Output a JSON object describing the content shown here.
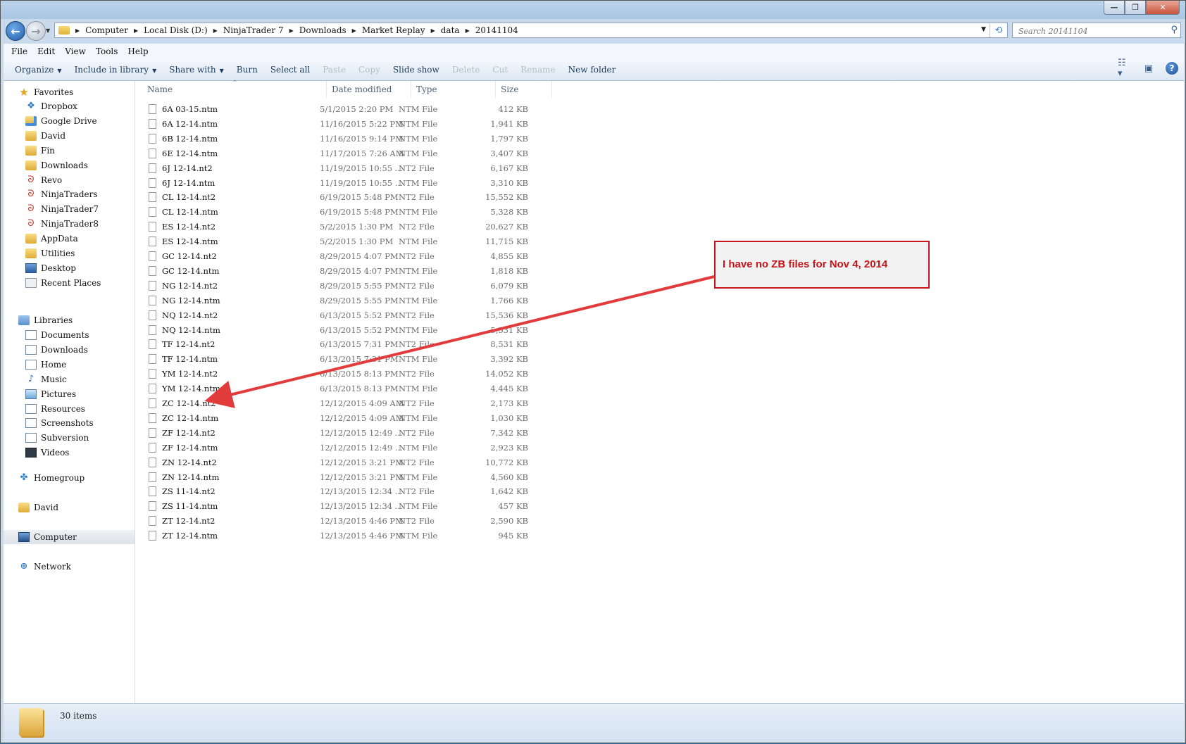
{
  "window": {
    "controls": {
      "minimize": "—",
      "maximize": "❐",
      "close": "✕"
    }
  },
  "address": {
    "crumbs": [
      "Computer",
      "Local Disk (D:)",
      "NinjaTrader 7",
      "Downloads",
      "Market Replay",
      "data",
      "20141104"
    ],
    "search_placeholder": "Search 20141104"
  },
  "menu": [
    "File",
    "Edit",
    "View",
    "Tools",
    "Help"
  ],
  "toolbar": {
    "organize": "Organize",
    "include_in_library": "Include in library",
    "share_with": "Share with",
    "burn": "Burn",
    "select_all": "Select all",
    "paste": "Paste",
    "copy": "Copy",
    "slide_show": "Slide show",
    "delete": "Delete",
    "cut": "Cut",
    "rename": "Rename",
    "new_folder": "New folder"
  },
  "nav": {
    "favorites_header": "Favorites",
    "favorites": [
      {
        "label": "Dropbox",
        "icon": "dropbox-icon"
      },
      {
        "label": "Google Drive",
        "icon": "google-drive-icon"
      },
      {
        "label": "David",
        "icon": "user-folder-icon"
      },
      {
        "label": "Fin",
        "icon": "folder-icon"
      },
      {
        "label": "Downloads",
        "icon": "folder-icon"
      },
      {
        "label": "Revo",
        "icon": "ninja-icon"
      },
      {
        "label": "NinjaTraders",
        "icon": "ninja-icon"
      },
      {
        "label": "NinjaTrader7",
        "icon": "ninja-icon"
      },
      {
        "label": "NinjaTrader8",
        "icon": "ninja-icon"
      },
      {
        "label": "AppData",
        "icon": "folder-icon"
      },
      {
        "label": "Utilities",
        "icon": "folder-icon"
      },
      {
        "label": "Desktop",
        "icon": "desktop-icon"
      },
      {
        "label": "Recent Places",
        "icon": "recent-places-icon"
      }
    ],
    "libraries_header": "Libraries",
    "libraries": [
      {
        "label": "Documents",
        "icon": "documents-icon"
      },
      {
        "label": "Downloads",
        "icon": "documents-icon"
      },
      {
        "label": "Home",
        "icon": "documents-icon"
      },
      {
        "label": "Music",
        "icon": "music-icon"
      },
      {
        "label": "Pictures",
        "icon": "pictures-icon"
      },
      {
        "label": "Resources",
        "icon": "documents-icon"
      },
      {
        "label": "Screenshots",
        "icon": "documents-icon"
      },
      {
        "label": "Subversion",
        "icon": "documents-icon"
      },
      {
        "label": "Videos",
        "icon": "videos-icon"
      }
    ],
    "homegroup": "Homegroup",
    "user": "David",
    "computer": "Computer",
    "network": "Network"
  },
  "columns": {
    "name": "Name",
    "date": "Date modified",
    "type": "Type",
    "size": "Size"
  },
  "files": [
    {
      "name": "6A 03-15.ntm",
      "date": "5/1/2015 2:20 PM",
      "type": "NTM File",
      "size": "412 KB"
    },
    {
      "name": "6A 12-14.ntm",
      "date": "11/16/2015 5:22 PM",
      "type": "NTM File",
      "size": "1,941 KB"
    },
    {
      "name": "6B 12-14.ntm",
      "date": "11/16/2015 9:14 PM",
      "type": "NTM File",
      "size": "1,797 KB"
    },
    {
      "name": "6E 12-14.ntm",
      "date": "11/17/2015 7:26 AM",
      "type": "NTM File",
      "size": "3,407 KB"
    },
    {
      "name": "6J 12-14.nt2",
      "date": "11/19/2015 10:55 ...",
      "type": "NT2 File",
      "size": "6,167 KB"
    },
    {
      "name": "6J 12-14.ntm",
      "date": "11/19/2015 10:55 ...",
      "type": "NTM File",
      "size": "3,310 KB"
    },
    {
      "name": "CL 12-14.nt2",
      "date": "6/19/2015 5:48 PM",
      "type": "NT2 File",
      "size": "15,552 KB"
    },
    {
      "name": "CL 12-14.ntm",
      "date": "6/19/2015 5:48 PM",
      "type": "NTM File",
      "size": "5,328 KB"
    },
    {
      "name": "ES 12-14.nt2",
      "date": "5/2/2015 1:30 PM",
      "type": "NT2 File",
      "size": "20,627 KB"
    },
    {
      "name": "ES 12-14.ntm",
      "date": "5/2/2015 1:30 PM",
      "type": "NTM File",
      "size": "11,715 KB"
    },
    {
      "name": "GC 12-14.nt2",
      "date": "8/29/2015 4:07 PM",
      "type": "NT2 File",
      "size": "4,855 KB"
    },
    {
      "name": "GC 12-14.ntm",
      "date": "8/29/2015 4:07 PM",
      "type": "NTM File",
      "size": "1,818 KB"
    },
    {
      "name": "NG 12-14.nt2",
      "date": "8/29/2015 5:55 PM",
      "type": "NT2 File",
      "size": "6,079 KB"
    },
    {
      "name": "NG 12-14.ntm",
      "date": "8/29/2015 5:55 PM",
      "type": "NTM File",
      "size": "1,766 KB"
    },
    {
      "name": "NQ 12-14.nt2",
      "date": "6/13/2015 5:52 PM",
      "type": "NT2 File",
      "size": "15,536 KB"
    },
    {
      "name": "NQ 12-14.ntm",
      "date": "6/13/2015 5:52 PM",
      "type": "NTM File",
      "size": "5,531 KB"
    },
    {
      "name": "TF 12-14.nt2",
      "date": "6/13/2015 7:31 PM",
      "type": "NT2 File",
      "size": "8,531 KB"
    },
    {
      "name": "TF 12-14.ntm",
      "date": "6/13/2015 7:31 PM",
      "type": "NTM File",
      "size": "3,392 KB"
    },
    {
      "name": "YM 12-14.nt2",
      "date": "6/13/2015 8:13 PM",
      "type": "NT2 File",
      "size": "14,052 KB"
    },
    {
      "name": "YM 12-14.ntm",
      "date": "6/13/2015 8:13 PM",
      "type": "NTM File",
      "size": "4,445 KB"
    },
    {
      "name": "ZC 12-14.nt2",
      "date": "12/12/2015 4:09 AM",
      "type": "NT2 File",
      "size": "2,173 KB"
    },
    {
      "name": "ZC 12-14.ntm",
      "date": "12/12/2015 4:09 AM",
      "type": "NTM File",
      "size": "1,030 KB"
    },
    {
      "name": "ZF 12-14.nt2",
      "date": "12/12/2015 12:49 ...",
      "type": "NT2 File",
      "size": "7,342 KB"
    },
    {
      "name": "ZF 12-14.ntm",
      "date": "12/12/2015 12:49 ...",
      "type": "NTM File",
      "size": "2,923 KB"
    },
    {
      "name": "ZN 12-14.nt2",
      "date": "12/12/2015 3:21 PM",
      "type": "NT2 File",
      "size": "10,772 KB"
    },
    {
      "name": "ZN 12-14.ntm",
      "date": "12/12/2015 3:21 PM",
      "type": "NTM File",
      "size": "4,560 KB"
    },
    {
      "name": "ZS 11-14.nt2",
      "date": "12/13/2015 12:34 ...",
      "type": "NT2 File",
      "size": "1,642 KB"
    },
    {
      "name": "ZS 11-14.ntm",
      "date": "12/13/2015 12:34 ...",
      "type": "NTM File",
      "size": "457 KB"
    },
    {
      "name": "ZT 12-14.nt2",
      "date": "12/13/2015 4:46 PM",
      "type": "NT2 File",
      "size": "2,590 KB"
    },
    {
      "name": "ZT 12-14.ntm",
      "date": "12/13/2015 4:46 PM",
      "type": "NTM File",
      "size": "945 KB"
    }
  ],
  "status": {
    "item_count": "30 items"
  },
  "annotation": {
    "text": "I have no ZB files for Nov 4, 2014",
    "color": "#c4161c"
  }
}
